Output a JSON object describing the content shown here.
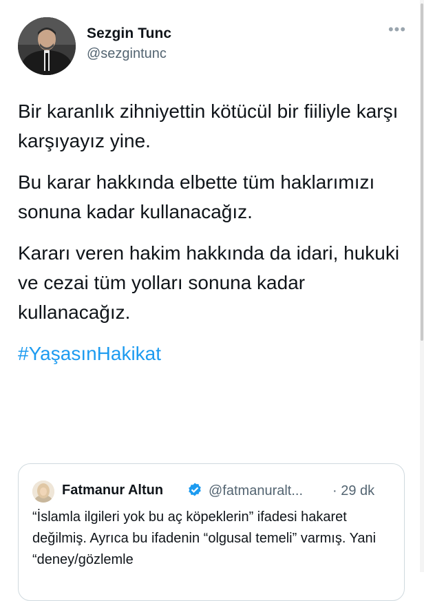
{
  "author": {
    "name": "Sezgin Tunc",
    "handle": "@sezgintunc"
  },
  "more_icon": "•••",
  "tweet": {
    "paragraph_1": "Bir karanlık zihniyettin kötücül bir fiiliyle karşı karşıyayız yine.",
    "paragraph_2": "Bu karar hakkında elbette tüm haklarımızı sonuna kadar kullanacağız.",
    "paragraph_3": "Kararı veren hakim hakkında da idari, hukuki ve cezai tüm yolları sonuna kadar kullanacağız.",
    "hashtag": "#YaşasınHakikat"
  },
  "quoted_tweet": {
    "name": "Fatmanur Altun",
    "handle": "@fatmanuralt...",
    "time": "· 29 dk",
    "text": "“İslamla ilgileri yok bu aç köpeklerin” ifadesi hakaret değilmiş. Ayrıca bu ifadenin “olgusal temeli” varmış. Yani “deney/gözlemle"
  },
  "colors": {
    "text": "#0f1419",
    "secondary": "#536471",
    "link": "#1d9bf0",
    "border": "#cfd9de"
  }
}
